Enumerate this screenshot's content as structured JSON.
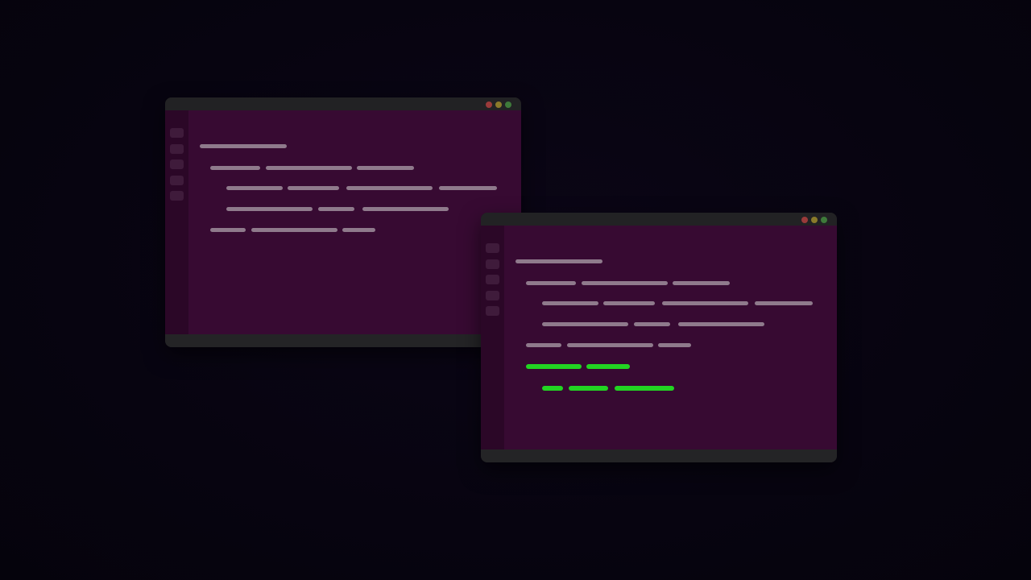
{
  "theme": {
    "background": "#070410",
    "terminal_body": "#370a32",
    "sidebar": "#2b0727",
    "titlebar": "#222224",
    "text_placeholder": "#8f7a8c",
    "highlight": "#22d422",
    "dot_red": "#9a3a3a",
    "dot_yellow": "#8a7a2a",
    "dot_green": "#3e7a3a"
  },
  "windows": [
    {
      "id": "terminal-window-back",
      "window_controls": [
        "close-dot",
        "minimize-dot",
        "maximize-dot"
      ],
      "sidebar_buttons": 5,
      "text_lines": 5,
      "highlighted_lines": 0
    },
    {
      "id": "terminal-window-front",
      "window_controls": [
        "close-dot",
        "minimize-dot",
        "maximize-dot"
      ],
      "sidebar_buttons": 5,
      "text_lines": 7,
      "highlighted_lines": 2
    }
  ]
}
